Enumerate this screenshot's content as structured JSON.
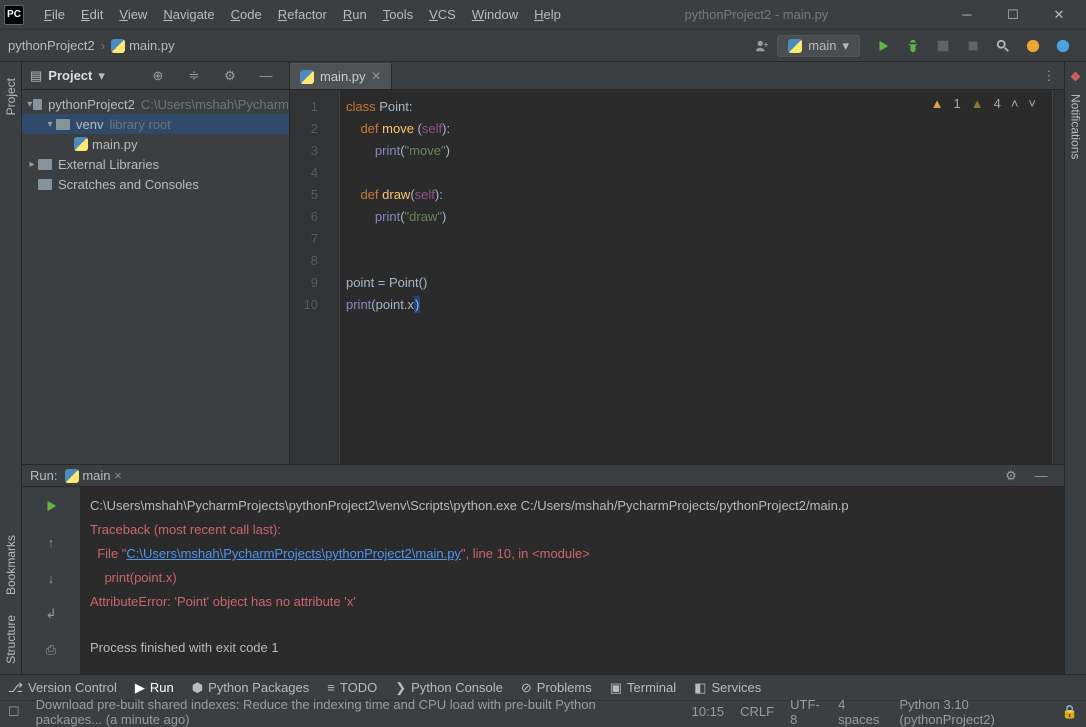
{
  "window": {
    "title": "pythonProject2 - main.py"
  },
  "menu": [
    "File",
    "Edit",
    "View",
    "Navigate",
    "Code",
    "Refactor",
    "Run",
    "Tools",
    "VCS",
    "Window",
    "Help"
  ],
  "crumbs": [
    "pythonProject2",
    "main.py"
  ],
  "run_config": {
    "name": "main"
  },
  "toolbar_icons": [
    "run",
    "debug",
    "coverage",
    "stop",
    "search",
    "update",
    "avatar"
  ],
  "project_panel": {
    "title": "Project",
    "nodes": [
      {
        "kind": "root",
        "label": "pythonProject2",
        "detail": "C:\\Users\\mshah\\Pycharm",
        "expanded": true
      },
      {
        "kind": "dir",
        "label": "venv",
        "detail": "library root",
        "expanded": true,
        "selected": true
      },
      {
        "kind": "file",
        "label": "main.py"
      },
      {
        "kind": "lib",
        "label": "External Libraries",
        "expanded": false
      },
      {
        "kind": "scr",
        "label": "Scratches and Consoles"
      }
    ]
  },
  "tabs": [
    {
      "label": "main.py",
      "active": true
    }
  ],
  "warnings": {
    "amber": "1",
    "soft": "4"
  },
  "gutter_lines": [
    "1",
    "2",
    "3",
    "4",
    "5",
    "6",
    "7",
    "8",
    "9",
    "10"
  ],
  "code_lines": [
    [
      {
        "t": "class ",
        "c": "kw"
      },
      {
        "t": "Point:",
        "c": "id"
      }
    ],
    [
      {
        "t": "    ",
        "c": ""
      },
      {
        "t": "def ",
        "c": "kw"
      },
      {
        "t": "move ",
        "c": "fn"
      },
      {
        "t": "(",
        "c": ""
      },
      {
        "t": "self",
        "c": "par"
      },
      {
        "t": "):",
        "c": ""
      }
    ],
    [
      {
        "t": "        ",
        "c": ""
      },
      {
        "t": "print",
        "c": "builtin"
      },
      {
        "t": "(",
        "c": ""
      },
      {
        "t": "\"move\"",
        "c": "str"
      },
      {
        "t": ")",
        "c": ""
      }
    ],
    [],
    [
      {
        "t": "    ",
        "c": ""
      },
      {
        "t": "def ",
        "c": "kw"
      },
      {
        "t": "draw",
        "c": "fn"
      },
      {
        "t": "(",
        "c": ""
      },
      {
        "t": "self",
        "c": "par"
      },
      {
        "t": "):",
        "c": ""
      }
    ],
    [
      {
        "t": "        ",
        "c": ""
      },
      {
        "t": "print",
        "c": "builtin"
      },
      {
        "t": "(",
        "c": ""
      },
      {
        "t": "\"draw\"",
        "c": "str"
      },
      {
        "t": ")",
        "c": ""
      }
    ],
    [],
    [],
    [
      {
        "t": "point = Point()",
        "c": "id"
      }
    ],
    [
      {
        "t": "print",
        "c": "builtin"
      },
      {
        "t": "(point.",
        "c": "id"
      },
      {
        "t": "x",
        "c": "id"
      },
      {
        "t": ")",
        "c": "caret"
      }
    ]
  ],
  "run": {
    "label": "Run:",
    "tab": "main",
    "output": {
      "cmd": "C:\\Users\\mshah\\PycharmProjects\\pythonProject2\\venv\\Scripts\\python.exe C:/Users/mshah/PycharmProjects/pythonProject2/main.p",
      "trace_head": "Traceback (most recent call last):",
      "file_prefix": "  File \"",
      "file_link": "C:\\Users\\mshah\\PycharmProjects\\pythonProject2\\main.py",
      "file_suffix": "\", line 10, in <module>",
      "call": "    print(point.x)",
      "error": "AttributeError: 'Point' object has no attribute 'x'",
      "exit": "Process finished with exit code 1"
    }
  },
  "side_tabs_left": [
    "Project",
    "Bookmarks",
    "Structure"
  ],
  "side_tabs_right": [
    "Notifications"
  ],
  "bottom_tabs": [
    "Version Control",
    "Run",
    "Python Packages",
    "TODO",
    "Python Console",
    "Problems",
    "Terminal",
    "Services"
  ],
  "status": {
    "hint": "Download pre-built shared indexes: Reduce the indexing time and CPU load with pre-built Python packages... (a minute ago)",
    "cursor": "10:15",
    "eol": "CRLF",
    "enc": "UTF-8",
    "indent": "4 spaces",
    "interp": "Python 3.10 (pythonProject2)"
  }
}
